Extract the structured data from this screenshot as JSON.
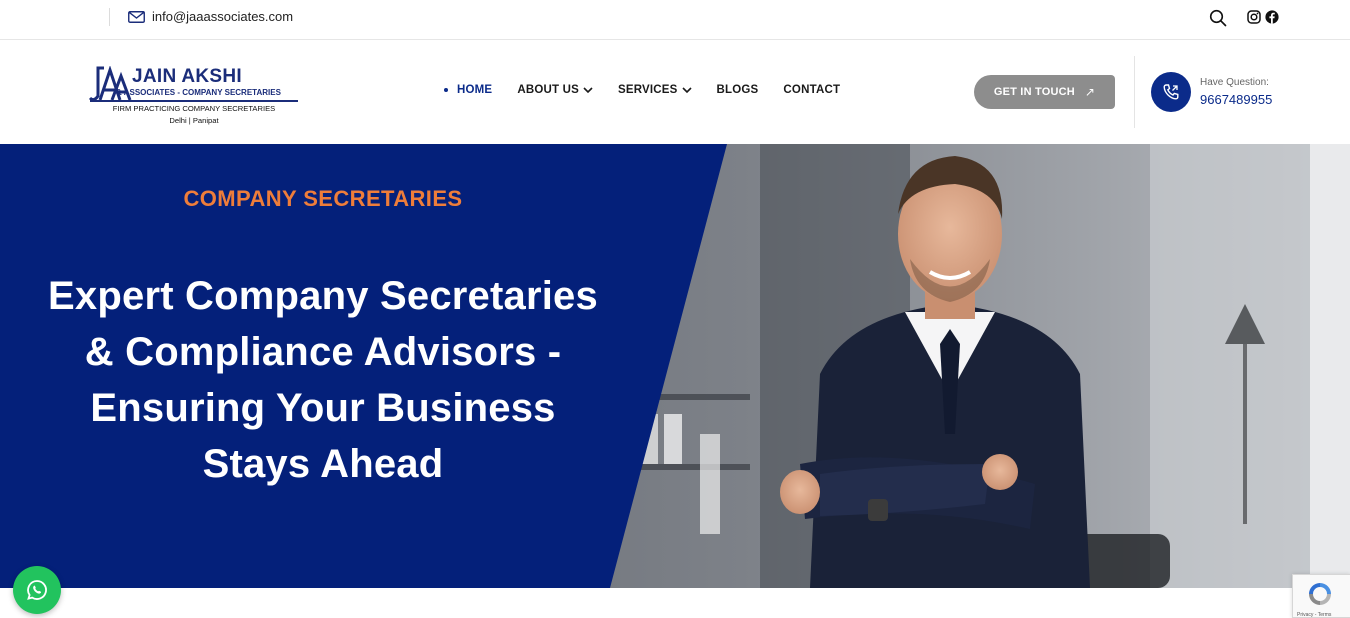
{
  "topbar": {
    "email": "info@jaaassociates.com",
    "icons": {
      "mail": "envelope-icon",
      "search": "search-icon",
      "instagram": "instagram-icon",
      "facebook": "facebook-icon"
    }
  },
  "logo": {
    "monogram": "JAA",
    "name": "JAIN AKSHI",
    "subtitle": "& ASSOCIATES - COMPANY SECRETARIES",
    "tagline": "FIRM PRACTICING COMPANY SECRETARIES",
    "location": "Delhi | Panipat"
  },
  "nav": {
    "items": [
      {
        "label": "HOME",
        "active": true
      },
      {
        "label": "ABOUT US",
        "dropdown": true
      },
      {
        "label": "SERVICES",
        "dropdown": true
      },
      {
        "label": "BLOGS"
      },
      {
        "label": "CONTACT"
      }
    ]
  },
  "cta": {
    "label": "GET IN TOUCH",
    "arrow": "↗"
  },
  "contact": {
    "label": "Have Question:",
    "phone": "9667489955",
    "icon": "phone-icon"
  },
  "hero": {
    "kicker": "COMPANY SECRETARIES",
    "headline_lines": [
      "Expert Company Secretaries",
      "& Compliance Advisors -",
      "Ensuring Your Business",
      "Stays Ahead"
    ]
  },
  "widgets": {
    "whatsapp_icon": "whatsapp-icon",
    "recaptcha_text": "Privacy - Terms"
  },
  "colors": {
    "brand_blue": "#0b2b8a",
    "hero_blue": "#04207a",
    "accent_orange": "#ee7d3a",
    "cta_gray": "#8d8d8d",
    "whatsapp_green": "#22c35e"
  }
}
